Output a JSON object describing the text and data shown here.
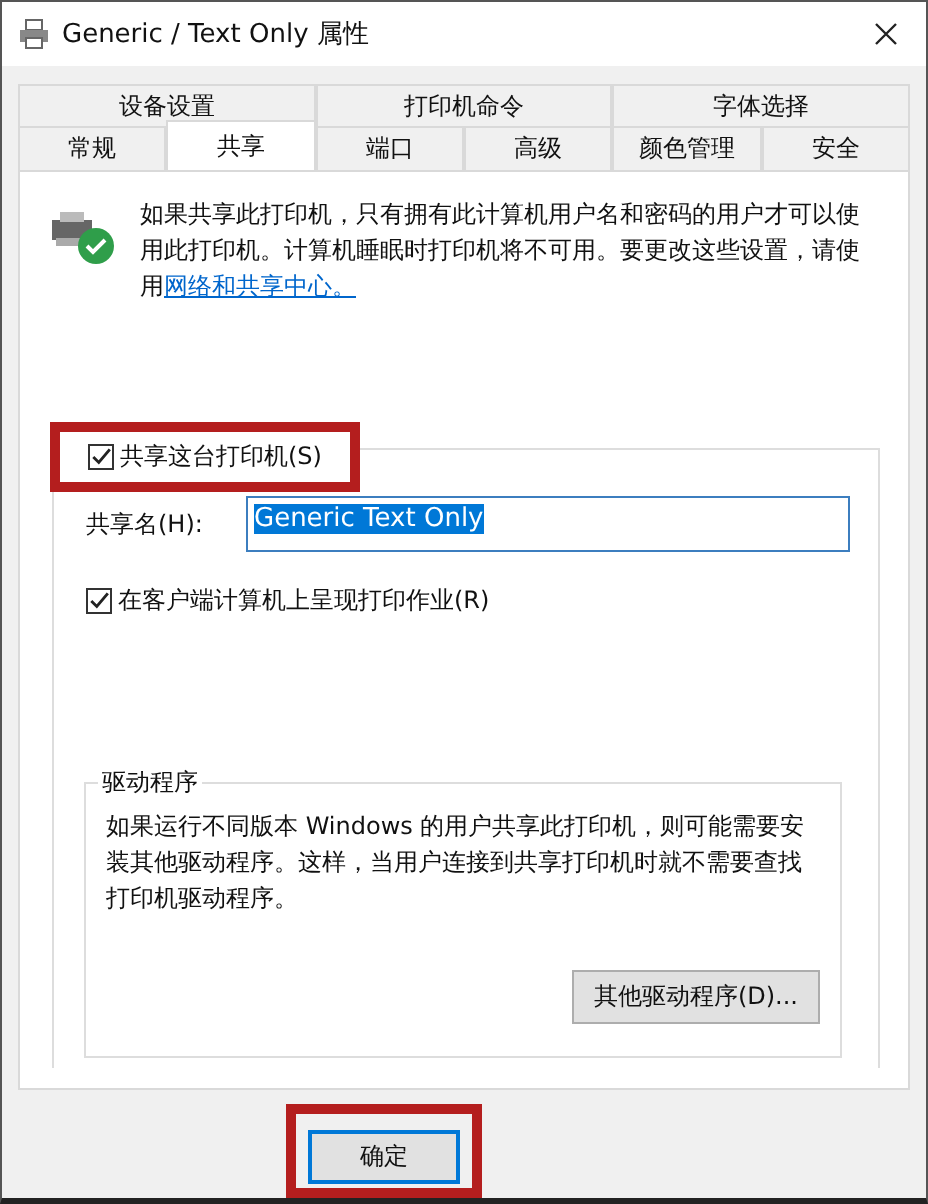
{
  "window": {
    "title": "Generic / Text Only 属性"
  },
  "tab_rows": [
    [
      {
        "label": "设备设置",
        "selected": false
      },
      {
        "label": "打印机命令",
        "selected": false
      },
      {
        "label": "字体选择",
        "selected": false
      }
    ],
    [
      {
        "label": "常规",
        "selected": false
      },
      {
        "label": "共享",
        "selected": true
      },
      {
        "label": "端口",
        "selected": false
      },
      {
        "label": "高级",
        "selected": false
      },
      {
        "label": "颜色管理",
        "selected": false
      },
      {
        "label": "安全",
        "selected": false
      }
    ]
  ],
  "intro": {
    "text": "如果共享此打印机，只有拥有此计算机用户名和密码的用户才可以使用此打印机。计算机睡眠时打印机将不可用。要更改这些设置，请使用",
    "link": "网络和共享中心。"
  },
  "share_checkbox": {
    "label": "共享这台打印机(S)",
    "checked": true,
    "highlighted": true
  },
  "share_name": {
    "label": "共享名(H):",
    "value": "Generic  Text Only",
    "selected": true
  },
  "render_checkbox": {
    "label": "在客户端计算机上呈现打印作业(R)",
    "checked": true
  },
  "drivers": {
    "title": "驱动程序",
    "text": "如果运行不同版本 Windows 的用户共享此打印机，则可能需要安装其他驱动程序。这样，当用户连接到共享打印机时就不需要查找打印机驱动程序。",
    "button": "其他驱动程序(D)..."
  },
  "buttons": [
    {
      "label": "确定",
      "highlighted": true
    }
  ]
}
